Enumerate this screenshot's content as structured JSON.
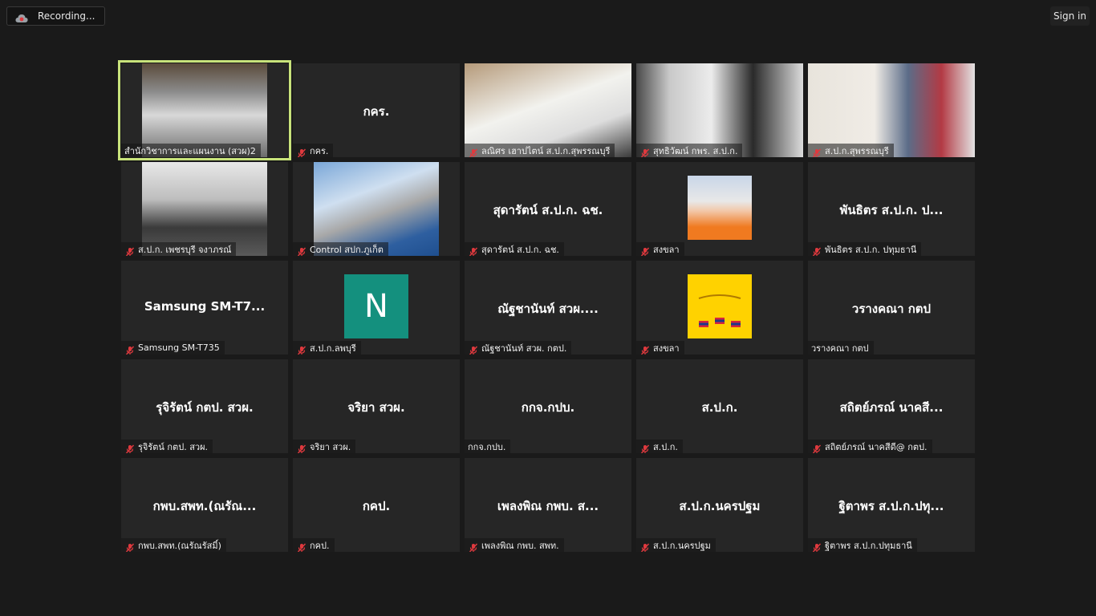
{
  "topbar": {
    "recording_label": "Recording...",
    "signin_label": "Sign in"
  },
  "participants": [
    {
      "title": "",
      "name": "สำนักวิชาการและแผนงาน (สวผ)2",
      "muted": false,
      "kind": "video"
    },
    {
      "title": "กคร.",
      "name": "กคร.",
      "muted": true,
      "kind": "text"
    },
    {
      "title": "",
      "name": "ลณิศร เฮาปไตน์ ส.ป.ก.สุพรรณบุรี",
      "muted": true,
      "kind": "video"
    },
    {
      "title": "",
      "name": "สุทธิวัฒน์ กพร. ส.ป.ก.",
      "muted": true,
      "kind": "video"
    },
    {
      "title": "",
      "name": "ส.ป.ก.สุพรรณบุรี",
      "muted": true,
      "kind": "video"
    },
    {
      "title": "",
      "name": "ส.ป.ก. เพชรบุรี จงาภรณ์",
      "muted": true,
      "kind": "video"
    },
    {
      "title": "",
      "name": "Control สปก.ภูเก็ต",
      "muted": true,
      "kind": "video"
    },
    {
      "title": "สุดารัตน์ ส.ป.ก. ฉช.",
      "name": "สุดารัตน์ ส.ป.ก. ฉช.",
      "muted": true,
      "kind": "text"
    },
    {
      "title": "",
      "name": "สงขลา",
      "muted": true,
      "kind": "photo"
    },
    {
      "title": "พันธิตร ส.ป.ก. ป...",
      "name": "พันธิตร ส.ป.ก. ปทุมธานี",
      "muted": true,
      "kind": "text"
    },
    {
      "title": "Samsung  SM-T7...",
      "name": "Samsung SM-T735",
      "muted": true,
      "kind": "text"
    },
    {
      "title": "",
      "name": "ส.ป.ก.ลพบุรี",
      "muted": true,
      "kind": "avatar",
      "avatar_letter": "N"
    },
    {
      "title": "ณัฐชานันท์ สวผ....",
      "name": "ณัฐชานันท์ สวผ. กตป.",
      "muted": true,
      "kind": "text"
    },
    {
      "title": "",
      "name": "สงขลา",
      "muted": true,
      "kind": "flag"
    },
    {
      "title": "วรางคณา กตป",
      "name": "วรางคณา กตป",
      "muted": false,
      "kind": "text"
    },
    {
      "title": "รุจิรัตน์ กตป. สวผ.",
      "name": "รุจิรัตน์ กตป. สวผ.",
      "muted": true,
      "kind": "text"
    },
    {
      "title": "จริยา สวผ.",
      "name": "จริยา สวผ.",
      "muted": true,
      "kind": "text"
    },
    {
      "title": "กกจ.กปบ.",
      "name": "กกจ.กปบ.",
      "muted": false,
      "kind": "text"
    },
    {
      "title": "ส.ป.ก.",
      "name": "ส.ป.ก.",
      "muted": true,
      "kind": "text"
    },
    {
      "title": "สถิตย์ภรณ์  นาคสี...",
      "name": "สถิตย์ภรณ์  นาคสีดี@ กตป.",
      "muted": true,
      "kind": "text"
    },
    {
      "title": "กพบ.สพท.(ณรัณ...",
      "name": "กพบ.สพท.(ณรัณรัสมิ์)",
      "muted": true,
      "kind": "text"
    },
    {
      "title": "กคป.",
      "name": "กคป.",
      "muted": true,
      "kind": "text"
    },
    {
      "title": "เพลงพิณ กพบ. ส...",
      "name": "เพลงพิณ กพบ. สพท.",
      "muted": true,
      "kind": "text"
    },
    {
      "title": "ส.ป.ก.นครปฐม",
      "name": "ส.ป.ก.นครปฐม",
      "muted": true,
      "kind": "text"
    },
    {
      "title": "ฐิตาพร ส.ป.ก.ปทุ...",
      "name": "ฐิตาพร ส.ป.ก.ปทุมธานี",
      "muted": true,
      "kind": "text"
    }
  ],
  "colors": {
    "background": "#1a1a1a",
    "tile": "#262626",
    "active_border": "#c8e37b",
    "mute_red": "#e0393e",
    "avatar": "#14907e"
  }
}
